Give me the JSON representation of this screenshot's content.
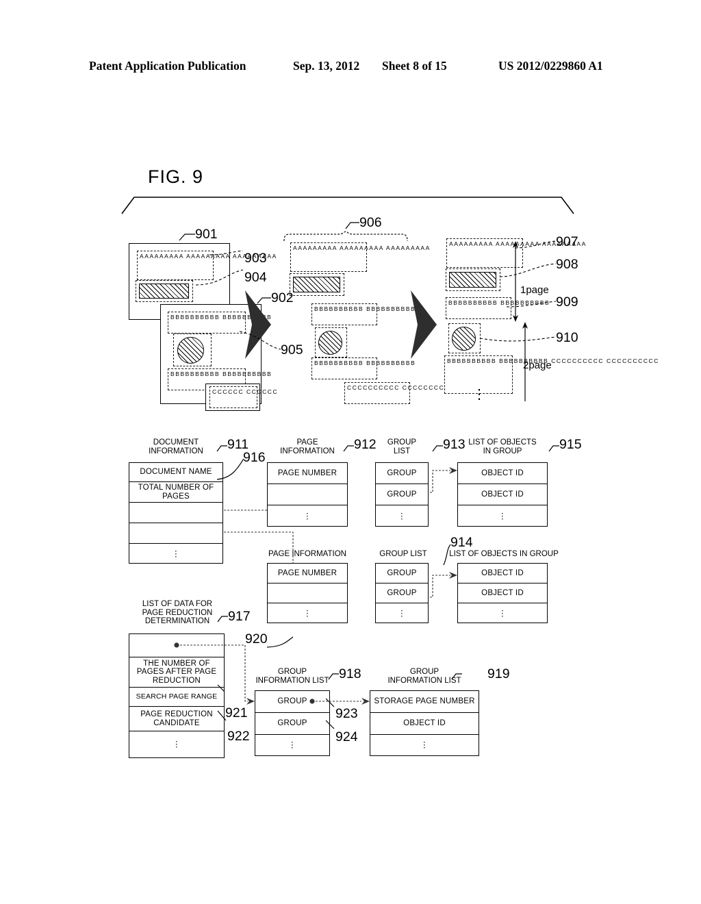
{
  "header": {
    "publication": "Patent Application Publication",
    "date": "Sep. 13, 2012",
    "sheet": "Sheet 8 of 15",
    "patent_number": "US 2012/0229860 A1"
  },
  "figure": {
    "label": "FIG. 9",
    "page_markers": {
      "one": "1page",
      "two": "2page"
    },
    "vertical_dots": "⋮"
  },
  "ref_numbers": {
    "n901": "901",
    "n902": "902",
    "n903": "903",
    "n904": "904",
    "n905": "905",
    "n906": "906",
    "n907": "907",
    "n908": "908",
    "n909": "909",
    "n910": "910",
    "n911": "911",
    "n912": "912",
    "n913": "913",
    "n914": "914",
    "n915": "915",
    "n916": "916",
    "n917": "917",
    "n918": "918",
    "n919": "919",
    "n920": "920",
    "n921": "921",
    "n922": "922",
    "n923": "923",
    "n924": "924"
  },
  "text_blocks": {
    "a3": "AAAAAAAAA\nAAAAAAAAA\nAAAAAAAAA",
    "b2": "BBBBBBBBBB\nBBBBBBBBBB",
    "b2_alt": "BBBBBBBBBB\nBBBBBBBBBB",
    "c2": "CCCCCCCCCC\nCCCCCCCCCC",
    "c2_short": "CCCCCC\nCCCCCC",
    "b2c2": "BBBBBBBBBB\nBBBBBBBBBB\nCCCCCCCCCC\nCCCCCCCCCC"
  },
  "tables": {
    "document_information": {
      "caption": "DOCUMENT\nINFORMATION",
      "rows": [
        "DOCUMENT NAME",
        "TOTAL NUMBER OF\nPAGES",
        "",
        "",
        "⋮"
      ]
    },
    "page_information_1": {
      "caption": "PAGE\nINFORMATION",
      "rows": [
        "PAGE NUMBER",
        "",
        "⋮"
      ]
    },
    "group_list_1": {
      "caption": "GROUP\nLIST",
      "rows": [
        "GROUP",
        "GROUP",
        "⋮"
      ]
    },
    "list_of_objects_1": {
      "caption": "LIST OF OBJECTS\nIN GROUP",
      "rows": [
        "OBJECT ID",
        "OBJECT ID",
        "⋮"
      ]
    },
    "page_information_2": {
      "caption": "PAGE INFORMATION",
      "rows": [
        "PAGE NUMBER",
        "",
        "⋮"
      ]
    },
    "group_list_2": {
      "caption": "GROUP LIST",
      "rows": [
        "GROUP",
        "GROUP",
        "⋮"
      ]
    },
    "list_of_objects_2": {
      "caption": "LIST OF OBJECTS IN GROUP",
      "rows": [
        "OBJECT ID",
        "OBJECT ID",
        "⋮"
      ]
    },
    "page_reduction_list": {
      "caption": "LIST OF DATA FOR\nPAGE REDUCTION\nDETERMINATION",
      "rows": [
        "",
        "THE NUMBER OF\nPAGES AFTER PAGE\nREDUCTION",
        "SEARCH PAGE RANGE",
        "PAGE REDUCTION\nCANDIDATE",
        "⋮"
      ]
    },
    "group_information_list_1": {
      "caption": "GROUP\nINFORMATION LIST",
      "rows": [
        "GROUP",
        "GROUP",
        "⋮"
      ]
    },
    "group_information_list_2": {
      "caption": "GROUP\nINFORMATION LIST",
      "rows": [
        "STORAGE PAGE NUMBER",
        "OBJECT ID",
        "⋮"
      ]
    }
  }
}
